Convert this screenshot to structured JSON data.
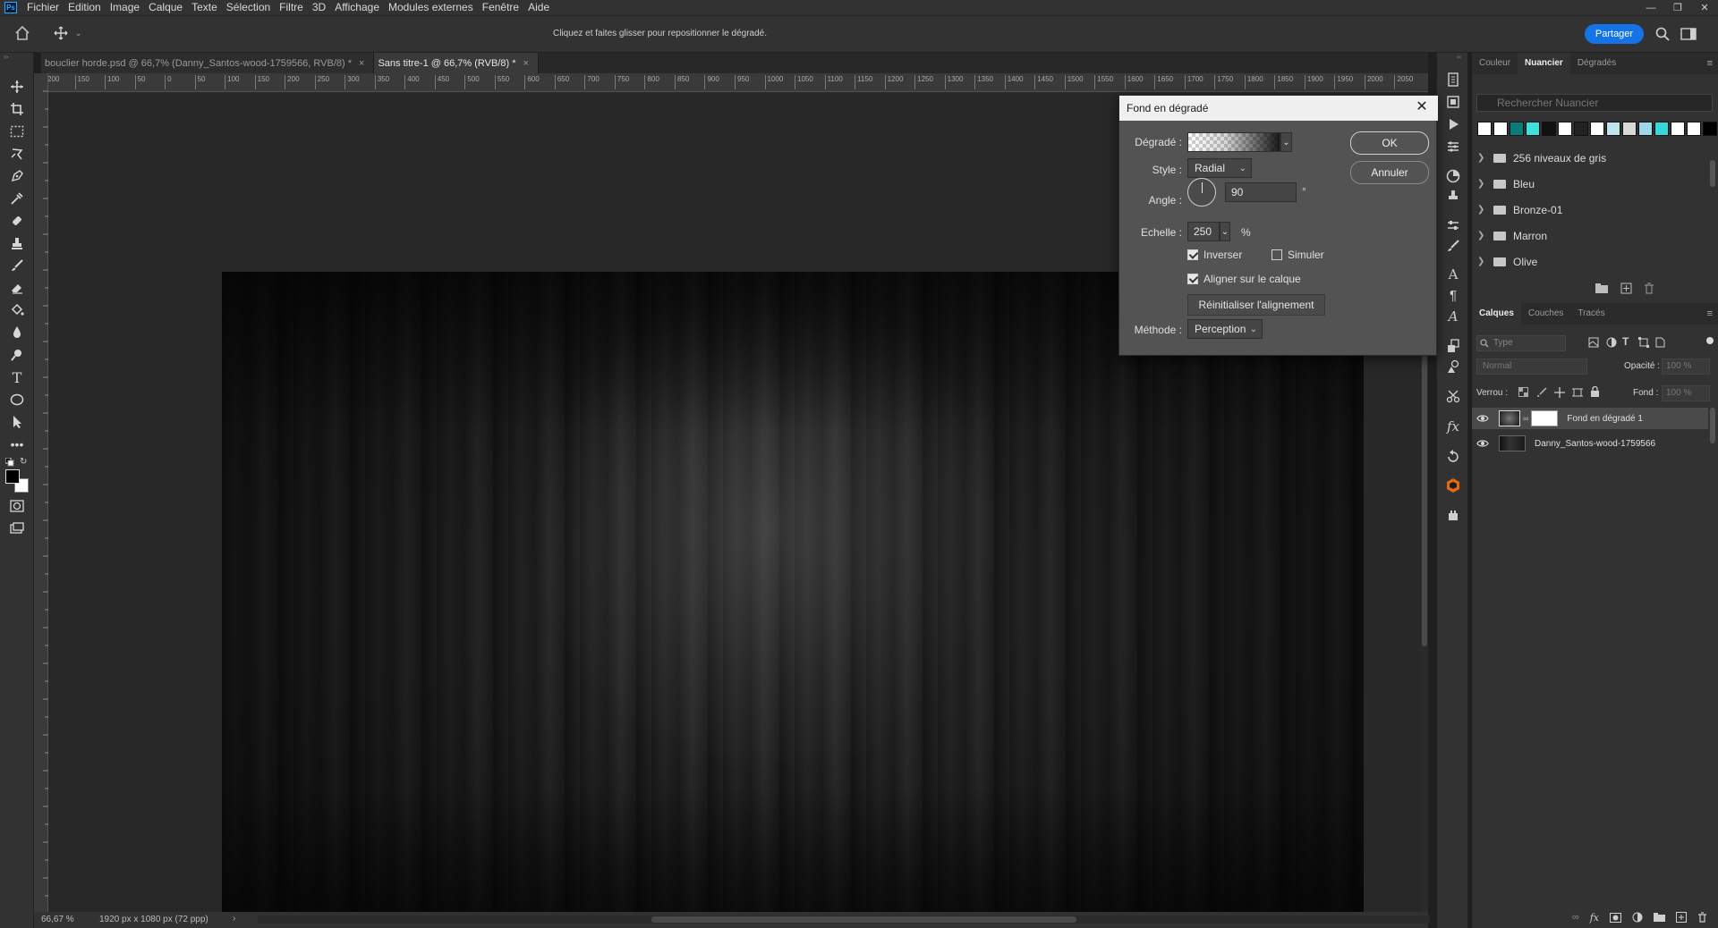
{
  "menu": {
    "logo": "Ps",
    "items": [
      "Fichier",
      "Edition",
      "Image",
      "Calque",
      "Texte",
      "Sélection",
      "Filtre",
      "3D",
      "Affichage",
      "Modules externes",
      "Fenêtre",
      "Aide"
    ]
  },
  "options_bar": {
    "hint": "Cliquez et faites glisser pour repositionner le dégradé.",
    "share_label": "Partager"
  },
  "tabs": [
    {
      "label": "bouclier horde.psd @ 66,7% (Danny_Santos-wood-1759566, RVB/8) *",
      "close": "×"
    },
    {
      "label": "Sans titre-1 @ 66,7% (RVB/8) *",
      "close": "×"
    }
  ],
  "ruler_top": [
    "200",
    "150",
    "100",
    "50",
    "0",
    "50",
    "100",
    "150",
    "200",
    "250",
    "300",
    "350",
    "400",
    "450",
    "500",
    "550",
    "600",
    "650",
    "700",
    "750",
    "800",
    "850",
    "900",
    "950",
    "1000",
    "1050",
    "1100",
    "1150",
    "1200",
    "1250",
    "1300",
    "1350",
    "1400",
    "1450",
    "1500",
    "1550",
    "1600",
    "1650",
    "1700",
    "1750",
    "1800",
    "1850",
    "1900",
    "1950",
    "2000",
    "2050"
  ],
  "status": {
    "zoom": "66,67 %",
    "doc_size": "1920 px x 1080 px (72 ppp)"
  },
  "dialog": {
    "title": "Fond en dégradé",
    "gradient_label": "Dégradé :",
    "style_label": "Style :",
    "style_value": "Radial",
    "angle_label": "Angle :",
    "angle_value": "90",
    "angle_unit": "°",
    "scale_label": "Echelle :",
    "scale_value": "250",
    "scale_unit": "%",
    "invert_label": "Inverser",
    "invert_checked": true,
    "dither_label": "Simuler",
    "dither_checked": false,
    "align_label": "Aligner sur le calque",
    "align_checked": true,
    "reset_label": "Réinitialiser l'alignement",
    "method_label": "Méthode :",
    "method_value": "Perception",
    "ok_label": "OK",
    "cancel_label": "Annuler"
  },
  "swatches_panel": {
    "tabs": [
      "Couleur",
      "Nuancier",
      "Dégradés"
    ],
    "active_tab": "Nuancier",
    "search_placeholder": "Rechercher Nuancier",
    "swatch_colors": [
      "#ffffff",
      "#ffffff",
      "#0a7a7a",
      "#3fe0dc",
      "#111111",
      "#ffffff",
      "#222222",
      "#ffffff",
      "#bfe3ee",
      "#d8d8d8",
      "#9fd6ea",
      "#38d8d8",
      "#ffffff",
      "#ffffff",
      "#000000"
    ],
    "folders": [
      "256 niveaux de gris",
      "Bleu",
      "Bronze-01",
      "Marron",
      "Olive"
    ]
  },
  "layers_panel": {
    "tabs": [
      "Calques",
      "Couches",
      "Tracés"
    ],
    "active_tab": "Calques",
    "filter_placeholder": "Type",
    "blend_mode": "Normal",
    "opacity_label": "Opacité :",
    "opacity_value": "100 %",
    "lock_label": "Verrou :",
    "fill_label": "Fond :",
    "fill_value": "100 %",
    "layers": [
      {
        "name": "Fond en dégradé 1",
        "selected": true
      },
      {
        "name": "Danny_Santos-wood-1759566",
        "selected": false
      }
    ]
  },
  "colors": {
    "accent": "#1473e6",
    "panel_bg": "#323232",
    "dialog_bg": "#535353"
  }
}
